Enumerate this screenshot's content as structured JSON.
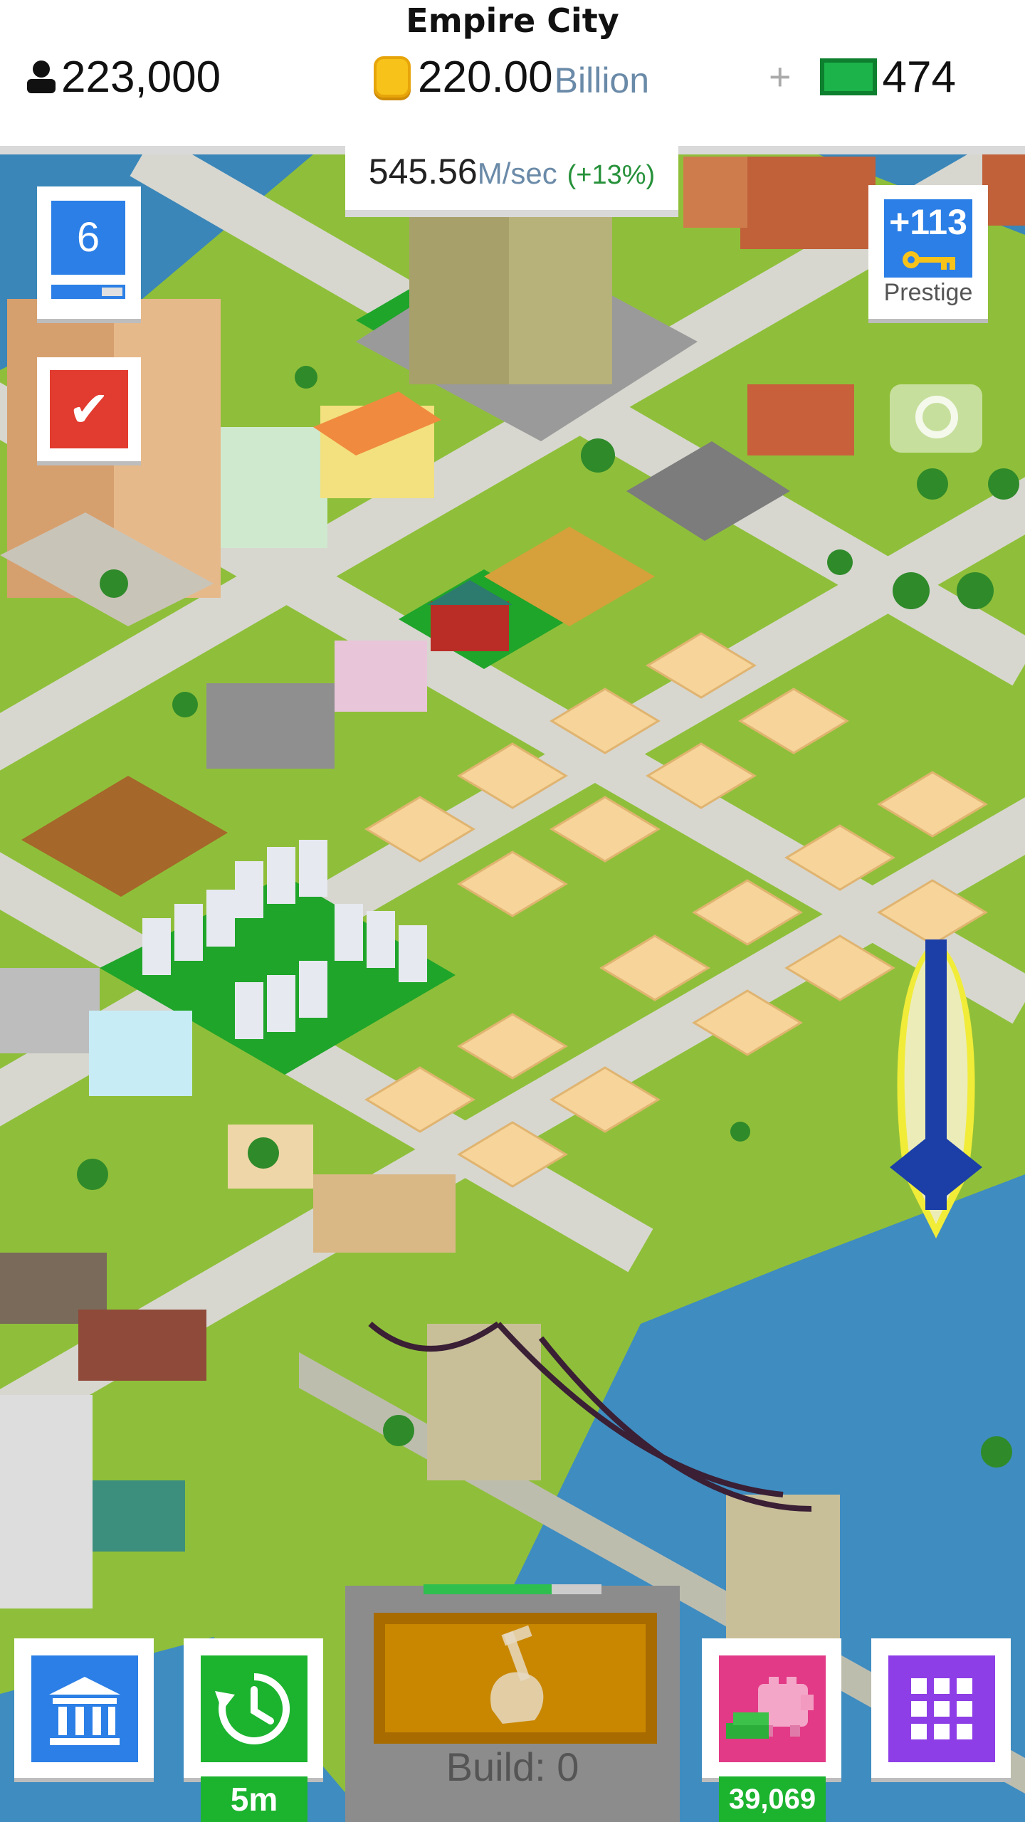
{
  "header": {
    "city_name": "Empire City",
    "population": "223,000",
    "money_amount": "220.00",
    "money_unit": "Billion",
    "plus_symbol": "+",
    "cash": "474"
  },
  "income": {
    "amount": "545.56",
    "unit": "M/sec",
    "bonus": "(+13%)"
  },
  "level": {
    "number": "6",
    "progress": 0.7
  },
  "prestige": {
    "value": "+113",
    "label": "Prestige"
  },
  "bottom_bar": {
    "time_label": "5m",
    "build_label": "Build: 0",
    "build_progress": 0.72,
    "piggy_amount": "39,069"
  },
  "icons": {
    "population": "person-icon",
    "money": "coin-icon",
    "cash": "cash-icon",
    "check": "checkmark-icon",
    "prestige": "key-icon",
    "camera": "camera-icon",
    "bank": "bank-icon",
    "time": "clock-icon",
    "build": "hammer-hand-icon",
    "piggy": "piggy-bank-icon",
    "grid": "grid-icon"
  },
  "colors": {
    "accent_blue": "#2b7fe6",
    "check_red": "#e23b2f",
    "time_green": "#1cb32f",
    "piggy_pink": "#e23a86",
    "grid_purple": "#8e3ee6",
    "build_gold": "#c98700"
  }
}
